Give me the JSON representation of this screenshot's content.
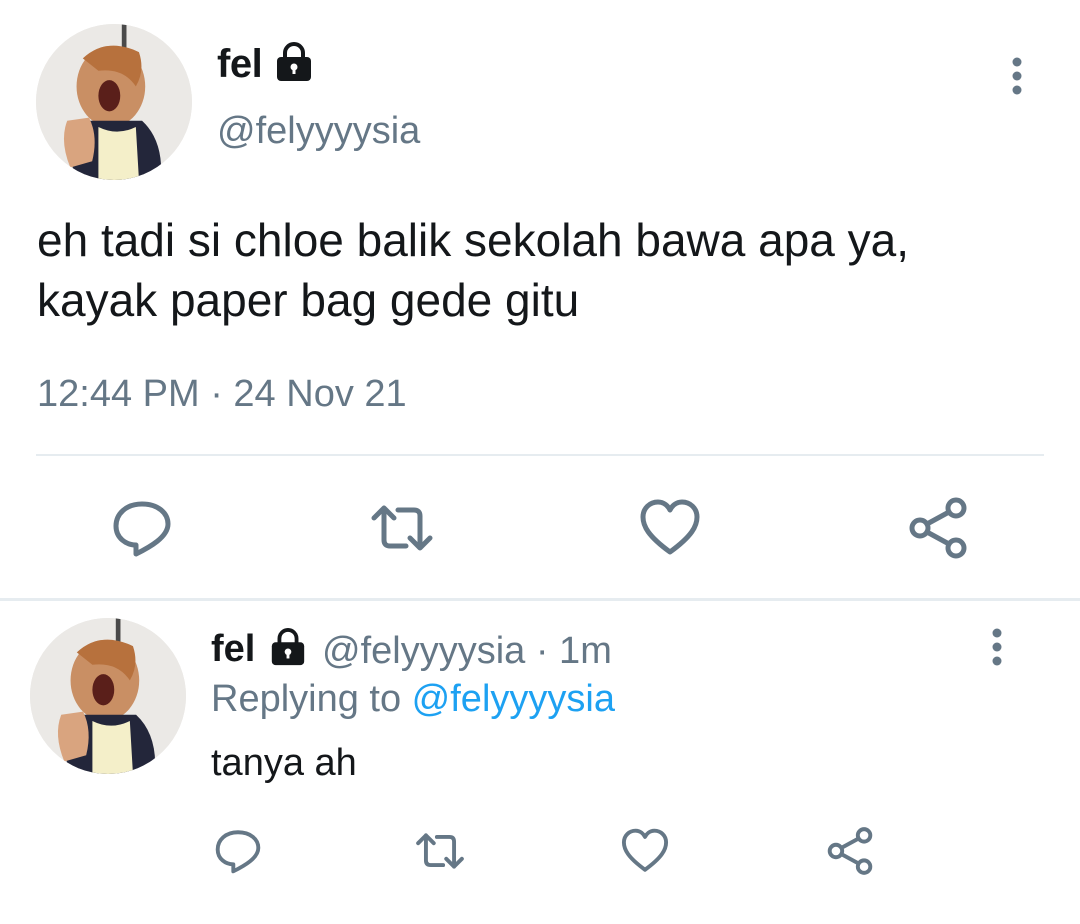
{
  "main_tweet": {
    "display_name": "fel",
    "handle": "@felyyyysia",
    "text": "eh tadi si chloe balik sekolah bawa apa ya, kayak paper bag gede gitu",
    "timestamp": "12:44 PM · 24 Nov 21",
    "icons": [
      "lock-icon",
      "more-vertical-icon",
      "reply-icon",
      "retweet-icon",
      "like-icon",
      "share-icon"
    ]
  },
  "reply_tweet": {
    "display_name": "fel",
    "meta": "@felyyyysia · 1m",
    "replying_prefix": "Replying to ",
    "replying_mention": "@felyyyysia",
    "text": "tanya ah",
    "icons": [
      "lock-icon",
      "more-vertical-icon",
      "reply-icon",
      "retweet-icon",
      "like-icon",
      "share-icon"
    ]
  },
  "colors": {
    "text_primary": "#14171a",
    "text_secondary": "#657786",
    "mention": "#1da1f2",
    "divider": "#e6ecf0"
  }
}
